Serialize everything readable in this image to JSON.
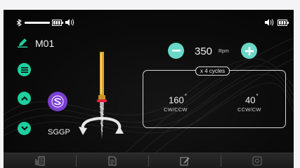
{
  "status_bar": {
    "bluetooth_icon": "bluetooth-icon",
    "signal_icon": "signal-line-icon",
    "battery_icon": "battery-icon",
    "volume_icon": "volume-icon"
  },
  "program": {
    "label": "M01",
    "icon": "pen-icon"
  },
  "speed": {
    "value": "350",
    "unit": "Rpm"
  },
  "mode": {
    "label": "SGGP"
  },
  "cycles": {
    "label": "x 4 cycles"
  },
  "angles": {
    "cw_ccw": {
      "value": "160",
      "label": "CW/CCW"
    },
    "ccw_cw": {
      "value": "40",
      "label": "CCW/CW"
    }
  },
  "tabs": [
    {
      "icon": "file-tool-icon"
    },
    {
      "icon": "document-icon"
    },
    {
      "icon": "edit-icon"
    },
    {
      "icon": "settings-icon"
    }
  ],
  "colors": {
    "accent": "#1fcf9e",
    "mode_purple": "#7a3fd2",
    "panel_border": "#d7d7d7"
  }
}
